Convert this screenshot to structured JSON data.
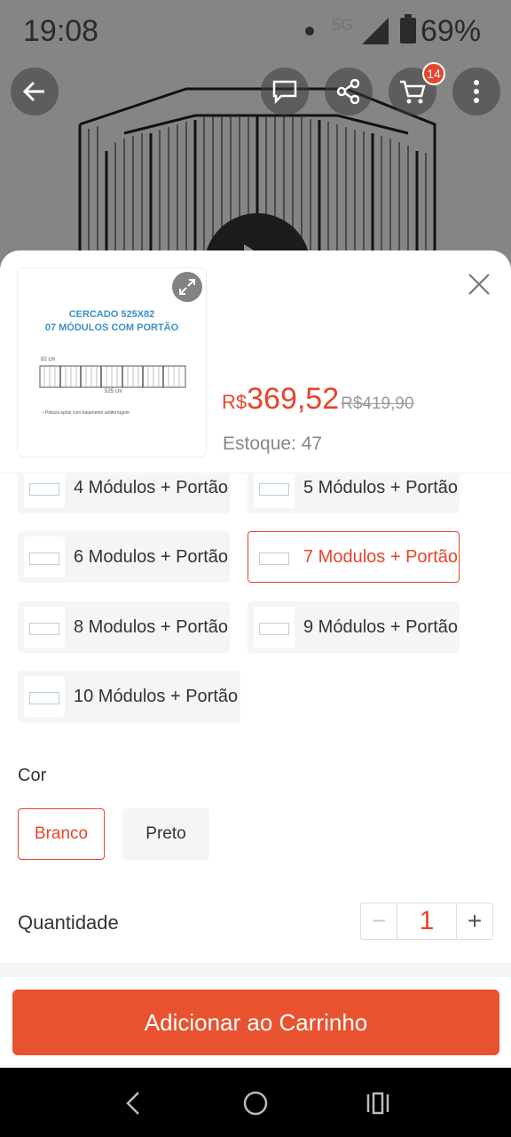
{
  "status_bar": {
    "time": "19:08",
    "network": "5G",
    "battery": "69%"
  },
  "header": {
    "cart_count": "14"
  },
  "product": {
    "thumb_title_line1": "CERCADO 525X82",
    "thumb_title_line2": "07 MÓDULOS COM PORTÃO",
    "thumb_dim_height": "82 cm",
    "thumb_dim_width": "525 cm",
    "thumb_note": "• Pintura epóxi com tratamento antiferrugem",
    "price_currency": "R$",
    "price_value": "369,52",
    "price_old": "R$419,90",
    "stock": "Estoque: 47"
  },
  "variations": [
    {
      "label": "4 Módulos + Portão",
      "selected": false
    },
    {
      "label": "5 Módulos + Portão",
      "selected": false
    },
    {
      "label": "6 Modulos + Portão",
      "selected": false
    },
    {
      "label": "7 Modulos + Portão",
      "selected": true
    },
    {
      "label": "8 Modulos + Portão",
      "selected": false
    },
    {
      "label": "9 Módulos + Portão",
      "selected": false
    },
    {
      "label": "10 Módulos + Portão",
      "selected": false
    }
  ],
  "color_section": {
    "label": "Cor",
    "options": [
      {
        "label": "Branco",
        "selected": true
      },
      {
        "label": "Preto",
        "selected": false
      }
    ]
  },
  "quantity": {
    "label": "Quantidade",
    "value": "1",
    "minus": "−",
    "plus": "+"
  },
  "add_to_cart": "Adicionar ao Carrinho",
  "colors": {
    "accent": "#e8442a",
    "button": "#e8522f"
  }
}
